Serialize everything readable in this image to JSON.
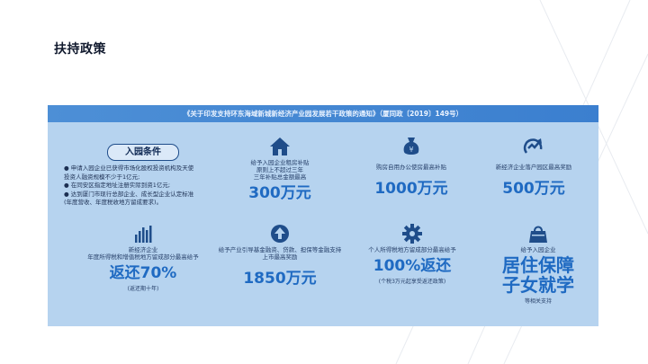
{
  "page": {
    "title": "扶持政策"
  },
  "banner": {
    "text": "《关于印发支持环东海域新城新经济产业园发展若干政策的通知》（厦同政〔2019〕149号）"
  },
  "entry": {
    "title": "入园条件",
    "items": [
      "● 申请入园企业已获得市场化股权投资机构及天使",
      "   投资人融资规模不少于1亿元;",
      "● 在同安区指定地址注册实际到资1亿元;",
      "● 达到厦门市现行总部企业、成长型企业认定标准",
      "   (年度营收、年度税收地方留成要求)。"
    ]
  },
  "cards": {
    "rent": {
      "icon": "house-icon",
      "desc": [
        "给予入园企业租房补贴",
        "原则上不超过三年",
        "三年补贴总金额最高"
      ],
      "value": "300万元"
    },
    "office": {
      "icon": "money-bag-icon",
      "desc": [
        "购房自用办公使房最高补贴"
      ],
      "value": "1000万元"
    },
    "award": {
      "icon": "growth-chart-icon",
      "desc": [
        "新经济企业落户园区最高奖励"
      ],
      "value": "500万元"
    },
    "tax": {
      "icon": "bar-chart-icon",
      "desc": [
        "新经济企业",
        "年度所得税和增值税地方留成部分最高给予"
      ],
      "value": "返还70%",
      "note": "(返还期十年)"
    },
    "fund": {
      "icon": "upload-arrow-icon",
      "desc": [
        "给予产业引导基金融资、贷款、担保等金融支持",
        "上市最高奖励"
      ],
      "value": "1850万元"
    },
    "personal": {
      "icon": "gear-icon",
      "desc": [
        "个人所得税地方留成部分最高给予"
      ],
      "value": "100%返还",
      "note": "(个税3万元起享受返还政策)"
    },
    "residence": {
      "icon": "shopping-bag-icon",
      "desc": [
        "给予入园企业"
      ],
      "value_line1": "居住保障",
      "value_line2": "子女就学",
      "note": "等相关支持"
    }
  },
  "colors": {
    "accent": "#1f6ac2",
    "panel": "#b6d3ef",
    "banner": "#3b7fcf"
  }
}
